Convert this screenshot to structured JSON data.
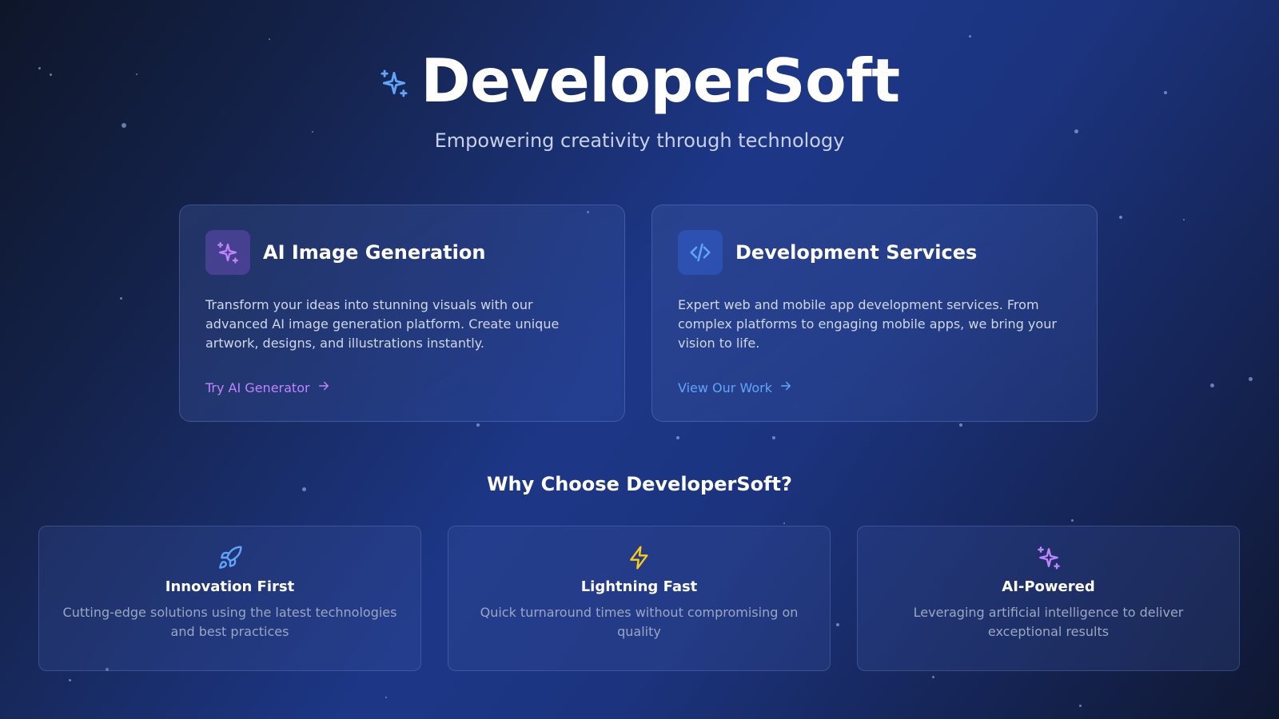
{
  "hero": {
    "icon": "sparkles-icon",
    "title": "DeveloperSoft",
    "tagline": "Empowering creativity through technology"
  },
  "services": [
    {
      "icon": "sparkles-icon",
      "title": "AI Image Generation",
      "description": "Transform your ideas into stunning visuals with our advanced AI image generation platform. Create unique artwork, designs, and illustrations instantly.",
      "link_label": "Try AI Generator",
      "accent": "#c084fc"
    },
    {
      "icon": "code-icon",
      "title": "Development Services",
      "description": "Expert web and mobile app development services. From complex platforms to engaging mobile apps, we bring your vision to life.",
      "link_label": "View Our Work",
      "accent": "#60a5fa"
    }
  ],
  "why": {
    "title": "Why Choose DeveloperSoft?"
  },
  "features": [
    {
      "icon": "rocket-icon",
      "title": "Innovation First",
      "description": "Cutting-edge solutions using the latest technologies and best practices",
      "accent": "#60a5fa"
    },
    {
      "icon": "lightning-icon",
      "title": "Lightning Fast",
      "description": "Quick turnaround times without compromising on quality",
      "accent": "#facc15"
    },
    {
      "icon": "sparkles-icon",
      "title": "AI-Powered",
      "description": "Leveraging artificial intelligence to deliver exceptional results",
      "accent": "#c084fc"
    }
  ],
  "colors": {
    "background_dark": "#0e1629",
    "background_blue": "#1d3787",
    "title_icon": "#60a5fa"
  }
}
